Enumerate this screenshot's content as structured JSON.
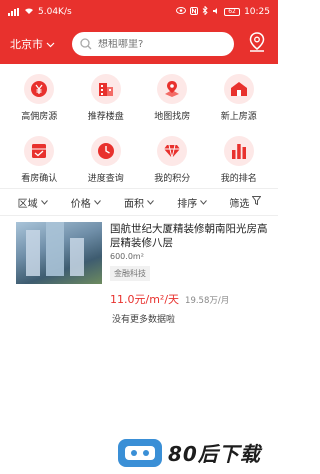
{
  "status_bar": {
    "left_text": "5.04K/s",
    "battery": "62",
    "time": "10:25"
  },
  "header": {
    "city": "北京市",
    "search_placeholder": "想租哪里?"
  },
  "grid": [
    {
      "label": "高佣房源",
      "icon": "yen-icon"
    },
    {
      "label": "推荐楼盘",
      "icon": "building-icon"
    },
    {
      "label": "地图找房",
      "icon": "map-pin-icon"
    },
    {
      "label": "新上房源",
      "icon": "new-house-icon"
    },
    {
      "label": "看房确认",
      "icon": "confirm-icon"
    },
    {
      "label": "进度查询",
      "icon": "clock-icon"
    },
    {
      "label": "我的积分",
      "icon": "diamond-icon"
    },
    {
      "label": "我的排名",
      "icon": "ranking-icon"
    }
  ],
  "filters": [
    "区域",
    "价格",
    "面积",
    "排序",
    "筛选"
  ],
  "listing": {
    "title": "国航世纪大厦精装修朝南阳光房高层精装修八层",
    "area": "600.0m²",
    "tag": "金融科技",
    "price": "11.0元/m²/天",
    "price_month": "19.58万/月"
  },
  "no_more": "没有更多数据啦",
  "watermark": {
    "text": "80后下载"
  },
  "colors": {
    "brand": "#e8312d",
    "icon_bg": "#fde8e7"
  }
}
